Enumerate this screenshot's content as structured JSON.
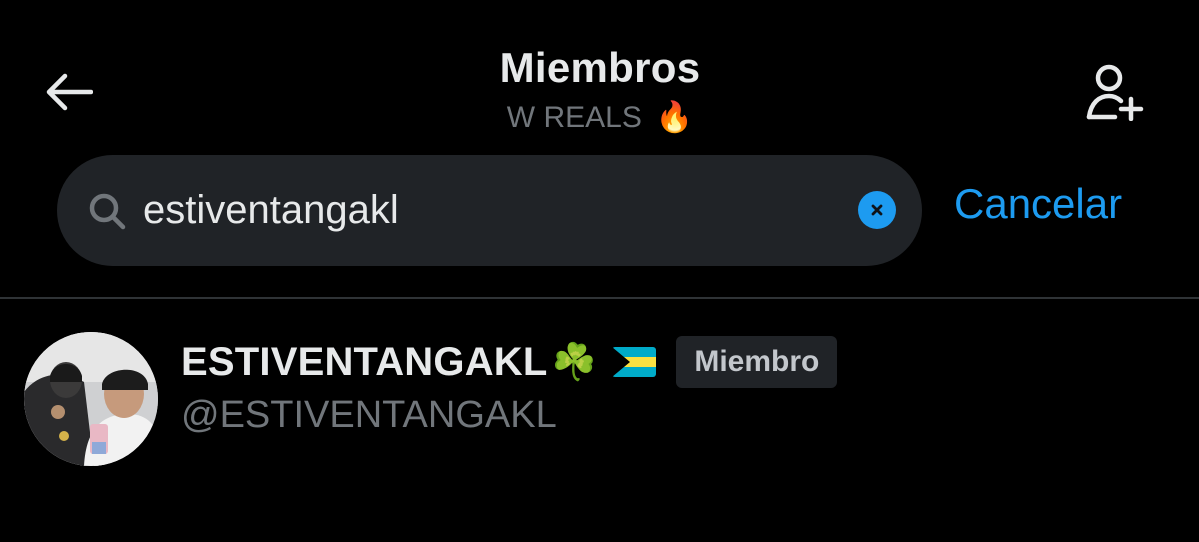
{
  "header": {
    "title": "Miembros",
    "subtitle": "W REALS",
    "subtitle_emoji": "🔥",
    "back_icon": "arrow-left-icon",
    "add_member_icon": "person-add-icon"
  },
  "search": {
    "value": "estiventangakl",
    "search_icon": "search-icon",
    "clear_icon": "clear-icon",
    "cancel_label": "Cancelar"
  },
  "results": [
    {
      "display_name": "ESTIVENTANGAKL",
      "name_emoji": "☘️",
      "flag_icon": "bahamas-flag-icon",
      "role": "Miembro",
      "handle": "@ESTIVENTANGAKL"
    }
  ],
  "colors": {
    "background": "#000000",
    "accent": "#1d9bf0",
    "search_bg": "#202327",
    "muted_text": "#71767b",
    "primary_text": "#e7e9ea",
    "divider": "#2f3336"
  }
}
